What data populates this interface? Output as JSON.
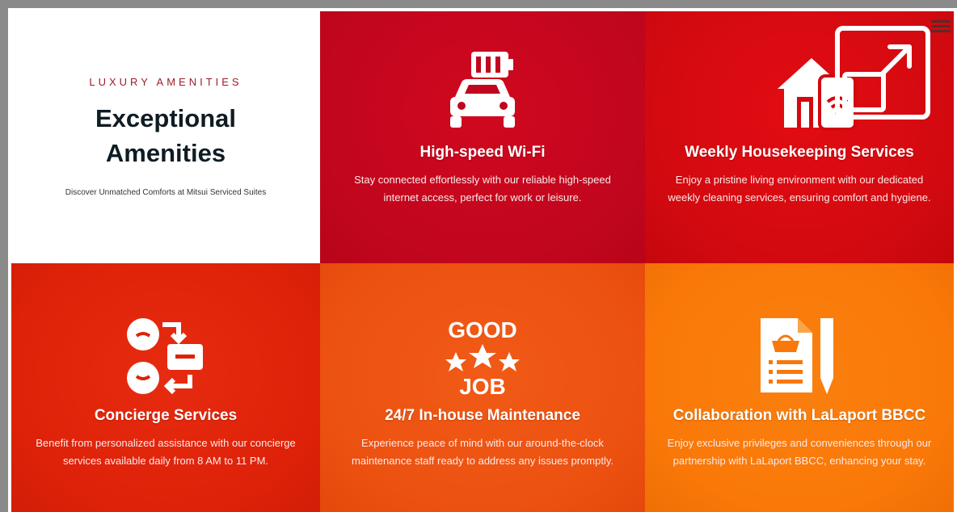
{
  "intro": {
    "eyebrow": "LUXURY AMENITIES",
    "title": "Exceptional Amenities",
    "subtitle": "Discover Unmatched Comforts at Mitsui Serviced Suites"
  },
  "tiles": [
    {
      "title": "High-speed Wi-Fi",
      "description": "Stay connected effortlessly with our reliable high-speed internet access, perfect for work or leisure.",
      "icon": "car-battery-icon",
      "color": "#c1061d"
    },
    {
      "title": "Weekly Housekeeping Services",
      "description": "Enjoy a pristine living environment with our dedicated weekly cleaning services, ensuring comfort and hygiene.",
      "icon": "smart-home-icon",
      "color": "#d20a10"
    },
    {
      "title": "Concierge Services",
      "description": "Benefit from personalized assistance with our concierge services available daily from 8 AM to 11 PM.",
      "icon": "concierge-exchange-icon",
      "color": "#dd2209"
    },
    {
      "title": "24/7 In-house Maintenance",
      "description": "Experience peace of mind with our around-the-clock maintenance staff ready to address any issues promptly.",
      "icon": "good-job-stars-icon",
      "icon_text_top": "GOOD",
      "icon_text_bottom": "JOB",
      "color": "#ec5110"
    },
    {
      "title": "Collaboration with LaLaport BBCC",
      "description": "Enjoy exclusive privileges and conveniences through our partnership with LaLaport BBCC, enhancing your stay.",
      "icon": "shopping-list-icon",
      "color": "#f97808"
    }
  ],
  "controls": {
    "expand": "expand-icon",
    "menu": "menu-icon"
  }
}
